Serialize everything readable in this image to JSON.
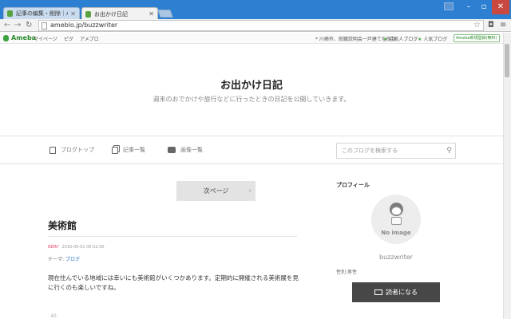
{
  "browser": {
    "tabs": [
      {
        "title": "記事の編集・削除｜Ameb"
      },
      {
        "title": "お出かけ日記"
      }
    ],
    "url": "ameblo.jp/buzzwriter"
  },
  "ameba_bar": {
    "logo": "Ameba",
    "links": [
      "マイページ",
      "ピグ",
      "アメブロ"
    ],
    "notice": "* 川崎市、就職説明会一戸建てを探せ",
    "ranking1": "芸能人ブログ",
    "ranking2": "人気ブログ",
    "register": "Ameba新規登録(無料)"
  },
  "header": {
    "title": "お出かけ日記",
    "subtitle": "週末のおでかけや旅行などに行ったときの日記を公開していきます。"
  },
  "nav": {
    "items": [
      "ブログトップ",
      "記事一覧",
      "画像一覧"
    ],
    "search_placeholder": "このブログを検索する"
  },
  "main": {
    "next_label": "次ページ",
    "post": {
      "title": "美術館",
      "new_label": "NEW!",
      "date": "2016-05-01 00:52:50",
      "theme_label": "テーマ:",
      "theme": "ブログ",
      "body": "現在住んでいる地域には幸いにも美術館がいくつかあります。定期的に開催される美術展を見に行くのも楽しいですね。",
      "footer": "40"
    }
  },
  "sidebar": {
    "profile_heading": "プロフィール",
    "avatar_caption": "No image",
    "username": "buzzwriter",
    "gender": "性別:男性",
    "reader_button": "読者になる"
  },
  "colors": {
    "titlebar": "#2d7fd1",
    "accent_green": "#3ea33e",
    "new_badge": "#e0446a",
    "reader_button": "#474747"
  }
}
